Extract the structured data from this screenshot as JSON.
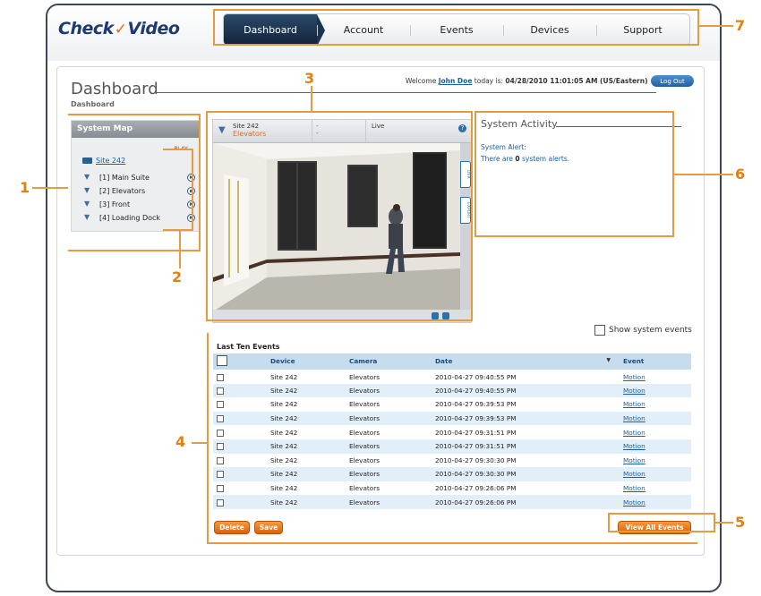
{
  "logo": {
    "part1": "Check",
    "mark": "✓",
    "part2": "Video"
  },
  "nav": {
    "tabs": [
      "Dashboard",
      "Account",
      "Events",
      "Devices",
      "Support"
    ]
  },
  "page": {
    "title": "Dashboard",
    "breadcrumb": "Dashboard"
  },
  "welcome": {
    "prefix": "Welcome",
    "user": "John Doe",
    "today_label": "today is:",
    "timestamp": "04/28/2010 11:01:05 AM (US/Eastern)",
    "logout": "Log Out"
  },
  "system_map": {
    "title": "System Map",
    "play_label": "PLAY",
    "site": "Site 242",
    "cameras": [
      "[1] Main Suite",
      "[2] Elevators",
      "[3] Front",
      "[4] Loading Dock"
    ]
  },
  "video": {
    "site": "Site 242",
    "location": "Elevators",
    "col2_top": "-",
    "col2_bottom": "-",
    "mode": "Live",
    "help": "?",
    "side_tabs": [
      "DVR",
      "EXPORT"
    ]
  },
  "activity": {
    "title": "System Activity",
    "alert_label": "System Alert:",
    "alert_prefix": "There are",
    "alert_count": "0",
    "alert_suffix": "system alerts."
  },
  "show_system_events": "Show system events",
  "events": {
    "title": "Last Ten Events",
    "columns": [
      "Device",
      "Camera",
      "Date",
      "Event"
    ],
    "rows": [
      {
        "device": "Site 242",
        "camera": "Elevators",
        "date": "2010-04-27 09:40:55 PM",
        "event": "Motion"
      },
      {
        "device": "Site 242",
        "camera": "Elevators",
        "date": "2010-04-27 09:40:55 PM",
        "event": "Motion"
      },
      {
        "device": "Site 242",
        "camera": "Elevators",
        "date": "2010-04-27 09:39:53 PM",
        "event": "Motion"
      },
      {
        "device": "Site 242",
        "camera": "Elevators",
        "date": "2010-04-27 09:39:53 PM",
        "event": "Motion"
      },
      {
        "device": "Site 242",
        "camera": "Elevators",
        "date": "2010-04-27 09:31:51 PM",
        "event": "Motion"
      },
      {
        "device": "Site 242",
        "camera": "Elevators",
        "date": "2010-04-27 09:31:51 PM",
        "event": "Motion"
      },
      {
        "device": "Site 242",
        "camera": "Elevators",
        "date": "2010-04-27 09:30:30 PM",
        "event": "Motion"
      },
      {
        "device": "Site 242",
        "camera": "Elevators",
        "date": "2010-04-27 09:30:30 PM",
        "event": "Motion"
      },
      {
        "device": "Site 242",
        "camera": "Elevators",
        "date": "2010-04-27 09:26:06 PM",
        "event": "Motion"
      },
      {
        "device": "Site 242",
        "camera": "Elevators",
        "date": "2010-04-27 09:26:06 PM",
        "event": "Motion"
      }
    ],
    "delete_label": "Delete",
    "save_label": "Save",
    "view_all_label": "View All Events"
  },
  "callouts": [
    "1",
    "2",
    "3",
    "4",
    "5",
    "6",
    "7"
  ],
  "colors": {
    "callout": "#e89b3e",
    "nav_active": "#1b3450",
    "link": "#1a5fa8",
    "button": "#e8761e"
  }
}
